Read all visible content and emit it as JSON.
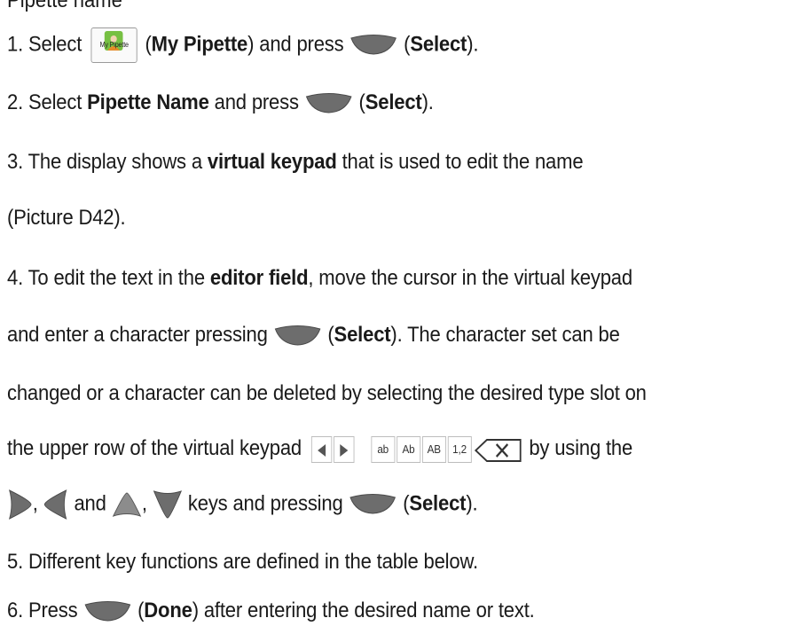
{
  "top_partial": "Pipette name",
  "icons": {
    "my_pipette_caption": "My Pipette"
  },
  "keypad": {
    "cells": [
      "ab",
      "Ab",
      "AB",
      "1,2"
    ]
  },
  "steps": [
    {
      "pre": "1.  Select",
      "paren_open": " (",
      "bold": "My Pipette",
      "mid": ") and press ",
      "paren2_open": " (",
      "bold2": "Select",
      "end": ")."
    },
    {
      "pre": "2.  Select ",
      "bold": "Pipette Name",
      "mid": " and press ",
      "paren2_open": " (",
      "bold2": "Select",
      "end": ")."
    },
    {
      "pre": "3.  The display shows a ",
      "bold": "virtual keypad",
      "end": " that is used to edit the name"
    },
    {
      "text": "(Picture D42)."
    },
    {
      "pre": "4.  To edit the text in the ",
      "bold": "editor field",
      "end": ", move the cursor in the virtual keypad"
    },
    {
      "pre": "and enter a character pressing ",
      "paren2_open": " (",
      "bold2": "Select",
      "end": "). The character set can be"
    },
    {
      "text": "changed or a character can be deleted by selecting the desired type slot on"
    },
    {
      "pre": "the upper row of the virtual keypad ",
      "end": "by using the"
    },
    {
      "comma1": ", ",
      "and": " and ",
      "comma2": ", ",
      "mid": " keys and pressing ",
      "paren2_open": " (",
      "bold2": "Select",
      "end": ")."
    },
    {
      "text": "5.  Different key functions are defined in the table below."
    },
    {
      "pre": "6.  Press ",
      "paren_open": " (",
      "bold": "Done",
      "end": ") after entering the desired name or text."
    }
  ]
}
